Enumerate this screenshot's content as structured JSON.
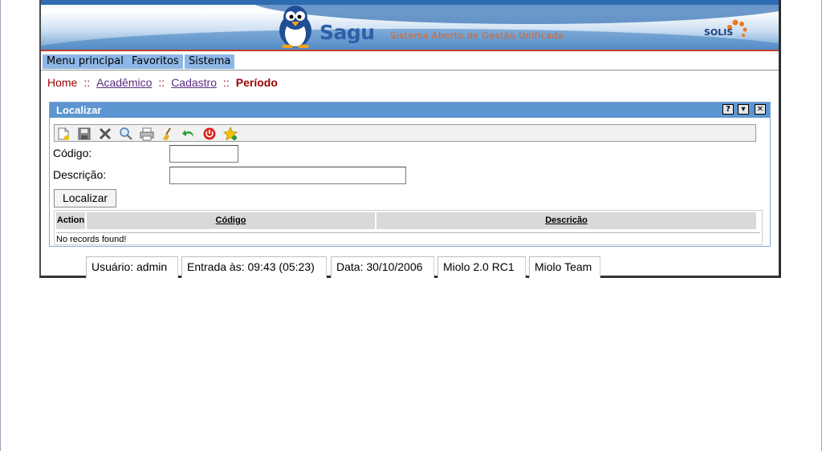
{
  "banner": {
    "brand": "Sagu",
    "tagline": "Sistema Aberto de Gestão Unificada",
    "partner_logo": "SOLIS"
  },
  "menu": {
    "items": [
      {
        "label": "Menu principal"
      },
      {
        "label": "Favoritos"
      },
      {
        "label": "Sistema"
      }
    ]
  },
  "breadcrumb": {
    "home": "Home",
    "separator": "::",
    "items": [
      "Acadêmico",
      "Cadastro"
    ],
    "current": "Período"
  },
  "panel": {
    "title": "Localizar",
    "title_buttons": [
      "?",
      "▾",
      "✕"
    ]
  },
  "toolbar": {
    "icons": [
      "new-icon",
      "save-icon",
      "delete-icon",
      "search-icon",
      "print-icon",
      "clear-icon",
      "back-icon",
      "exit-icon",
      "favorite-icon"
    ]
  },
  "form": {
    "code_label": "Código:",
    "code_value": "",
    "description_label": "Descrição:",
    "description_value": "",
    "find_button": "Localizar"
  },
  "grid": {
    "columns": [
      "Action",
      "Código",
      "Descrição"
    ],
    "empty_message": "No records found!"
  },
  "status": {
    "user": "Usuário: admin",
    "login": "Entrada às: 09:43 (05:23)",
    "date": "Data: 30/10/2006",
    "version": "Miolo 2.0 RC1",
    "team": "Miolo Team"
  },
  "colors": {
    "menu_bg": "#8db7e6",
    "panel_title_bg": "#5d95d0",
    "breadcrumb_red": "#990000",
    "breadcrumb_link": "#5a2a80"
  }
}
